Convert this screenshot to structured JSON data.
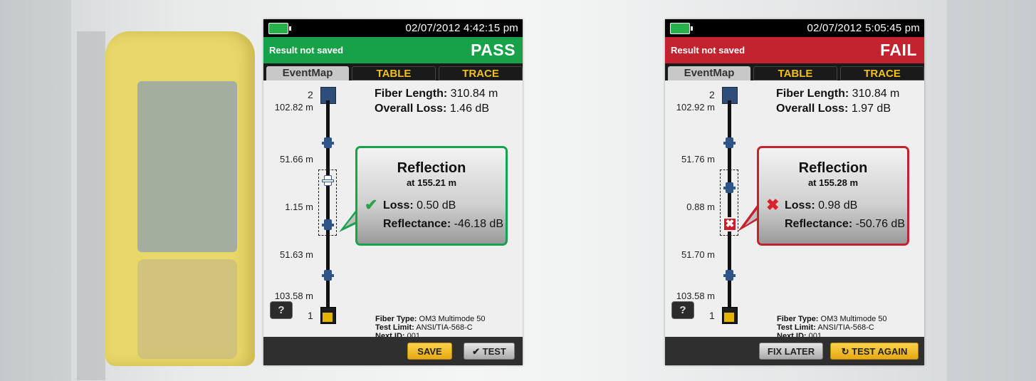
{
  "colors": {
    "pass": "#17a249",
    "fail": "#c3232f",
    "tab_text": "#f0c020",
    "button_yellow": "#ffd24a"
  },
  "screens": [
    {
      "datetime": "02/07/2012 4:42:15 pm",
      "saved_status": "Result not saved",
      "result": "PASS",
      "tabs": [
        "EventMap",
        "TABLE",
        "TRACE"
      ],
      "active_tab": "EventMap",
      "endpoints": [
        "2",
        "1"
      ],
      "distances": [
        "102.82 m",
        "51.66 m",
        "1.15 m",
        "51.63 m",
        "103.58 m"
      ],
      "summary": {
        "length_label": "Fiber Length:",
        "length_value": "310.84 m",
        "loss_label": "Overall Loss:",
        "loss_value": "1.46 dB"
      },
      "event": {
        "type": "Reflection",
        "location": "at 155.21 m",
        "status_icon": "check-icon",
        "loss_label": "Loss:",
        "loss_value": "0.50 dB",
        "reflectance_label": "Reflectance:",
        "reflectance_value": "-46.18 dB"
      },
      "info": {
        "fiber_type_label": "Fiber Type:",
        "fiber_type": "OM3 Multimode 50",
        "test_limit_label": "Test Limit:",
        "test_limit": "ANSI/TIA-568-C",
        "next_id_label": "Next ID:",
        "next_id": "001"
      },
      "help_label": "?",
      "buttons": [
        "SAVE",
        "TEST"
      ]
    },
    {
      "datetime": "02/07/2012 5:05:45 pm",
      "saved_status": "Result not saved",
      "result": "FAIL",
      "tabs": [
        "EventMap",
        "TABLE",
        "TRACE"
      ],
      "active_tab": "EventMap",
      "endpoints": [
        "2",
        "1"
      ],
      "distances": [
        "102.92 m",
        "51.76 m",
        "0.88 m",
        "51.70 m",
        "103.58 m"
      ],
      "summary": {
        "length_label": "Fiber Length:",
        "length_value": "310.84 m",
        "loss_label": "Overall Loss:",
        "loss_value": "1.97 dB"
      },
      "event": {
        "type": "Reflection",
        "location": "at 155.28 m",
        "status_icon": "x-icon",
        "loss_label": "Loss:",
        "loss_value": "0.98 dB",
        "reflectance_label": "Reflectance:",
        "reflectance_value": "-50.76 dB"
      },
      "info": {
        "fiber_type_label": "Fiber Type:",
        "fiber_type": "OM3 Multimode 50",
        "test_limit_label": "Test Limit:",
        "test_limit": "ANSI/TIA-568-C",
        "next_id_label": "Next ID:",
        "next_id": "001"
      },
      "help_label": "?",
      "buttons": [
        "FIX LATER",
        "TEST AGAIN"
      ]
    }
  ]
}
